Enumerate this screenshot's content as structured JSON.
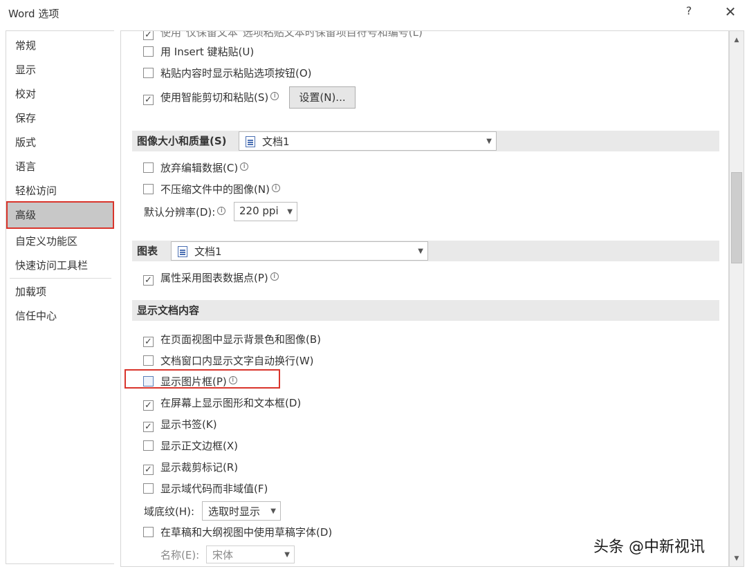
{
  "window": {
    "title": "Word 选项",
    "help": "?",
    "close": "✕"
  },
  "sidebar": {
    "items": [
      {
        "label": "常规"
      },
      {
        "label": "显示"
      },
      {
        "label": "校对"
      },
      {
        "label": "保存"
      },
      {
        "label": "版式"
      },
      {
        "label": "语言"
      },
      {
        "label": "轻松访问"
      },
      {
        "label": "高级"
      },
      {
        "label": "自定义功能区"
      },
      {
        "label": "快速访问工具栏"
      },
      {
        "label": "加载项"
      },
      {
        "label": "信任中心"
      }
    ],
    "selected": "高级"
  },
  "paste": {
    "cut_row": "使用\"仅保留文本\"选项粘贴文本时保留项目符号和编号(L)",
    "insert_key": {
      "label": "用 Insert 键粘贴(U)",
      "checked": false
    },
    "show_paste_btn": {
      "label": "粘贴内容时显示粘贴选项按钮(O)",
      "checked": false
    },
    "smart_cut": {
      "label": "使用智能剪切和粘贴(S)",
      "checked": true
    },
    "settings_btn": "设置(N)..."
  },
  "image_section": {
    "title": "图像大小和质量(S)",
    "doc": "文档1",
    "discard_edit": {
      "label": "放弃编辑数据(C)",
      "checked": false
    },
    "no_compress": {
      "label": "不压缩文件中的图像(N)",
      "checked": false
    },
    "resolution_label": "默认分辨率(D):",
    "resolution_value": "220 ppi"
  },
  "chart_section": {
    "title": "图表",
    "doc": "文档1",
    "follow_points": {
      "label": "属性采用图表数据点(P)",
      "checked": true
    }
  },
  "display_section": {
    "title": "显示文档内容",
    "items": [
      {
        "label": "在页面视图中显示背景色和图像(B)",
        "checked": true
      },
      {
        "label": "文档窗口内显示文字自动换行(W)",
        "checked": false
      },
      {
        "label": "显示图片框(P)",
        "checked": false
      },
      {
        "label": "在屏幕上显示图形和文本框(D)",
        "checked": true
      },
      {
        "label": "显示书签(K)",
        "checked": true
      },
      {
        "label": "显示正文边框(X)",
        "checked": false
      },
      {
        "label": "显示裁剪标记(R)",
        "checked": true
      },
      {
        "label": "显示域代码而非域值(F)",
        "checked": false
      }
    ],
    "field_shading_label": "域底纹(H):",
    "field_shading_value": "选取时显示",
    "draft_font": {
      "label": "在草稿和大纲视图中使用草稿字体(D)",
      "checked": false
    },
    "name_label": "名称(E):",
    "name_value": "宋体"
  },
  "watermark": "头条 @中新视讯",
  "colors": {
    "highlight": "#d9342b",
    "section_bg": "#e9e9e9",
    "selected_bg": "#c8c8c8"
  }
}
